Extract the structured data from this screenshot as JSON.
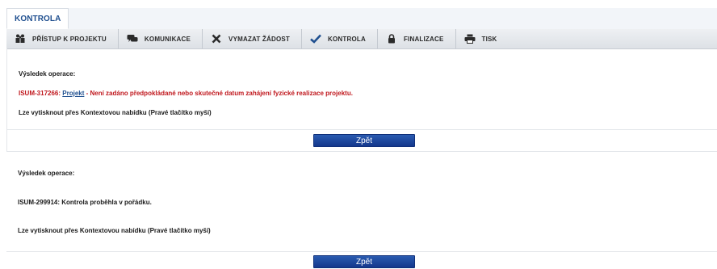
{
  "tab": {
    "label": "KONTROLA"
  },
  "toolbar": {
    "items": [
      {
        "label": "PŘÍSTUP K PROJEKTU",
        "icon": "people-icon"
      },
      {
        "label": "KOMUNIKACE",
        "icon": "chat-icon"
      },
      {
        "label": "VYMAZAT ŽÁDOST",
        "icon": "close-icon"
      },
      {
        "label": "KONTROLA",
        "icon": "check-icon"
      },
      {
        "label": "FINALIZACE",
        "icon": "lock-icon"
      },
      {
        "label": "TISK",
        "icon": "printer-icon"
      }
    ]
  },
  "result1": {
    "heading": "Výsledek operace:",
    "code": "ISUM-317266:",
    "link": "Projekt",
    "message": " - Není zadáno předpokládané nebo skutečné datum zahájení fyzické realizace projektu.",
    "print_hint": "Lze vytisknout přes Kontextovou nabídku (Pravé tlačítko myši)",
    "back_label": "Zpět"
  },
  "result2": {
    "heading": "Výsledek operace:",
    "message": "ISUM-299914: Kontrola proběhla v pořádku.",
    "print_hint": "Lze vytisknout přes Kontextovou nabídku (Pravé tlačítko myši)",
    "back_label": "Zpět"
  },
  "colors": {
    "error": "#c0181e",
    "link": "#1f4f8f",
    "button": "#1f4aa0"
  }
}
